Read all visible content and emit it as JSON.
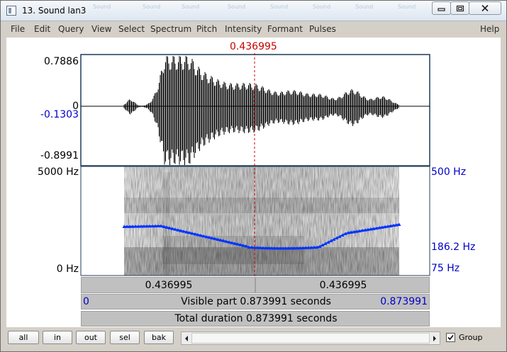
{
  "window": {
    "title": "13. Sound lan3",
    "ghost_titles": [
      "Sound",
      "Sound",
      "Sound",
      "Sound",
      "Sound",
      "Sound",
      "Sound",
      "Sound"
    ]
  },
  "menu": {
    "items": [
      "File",
      "Edit",
      "Query",
      "View",
      "Select",
      "Spectrum",
      "Pitch",
      "Intensity",
      "Formant",
      "Pulses"
    ],
    "help": "Help"
  },
  "cursor": {
    "time": "0.436995"
  },
  "waveform": {
    "max_label": "0.7886",
    "zero_label": "0",
    "cursor_value": "-0.1303",
    "min_label": "-0.8991"
  },
  "spectrogram": {
    "freq_max_label": "5000 Hz",
    "freq_min_label": "0 Hz",
    "pitch_max_label": "500 Hz",
    "pitch_mid_label": "186.2 Hz",
    "pitch_min_label": "75 Hz"
  },
  "time_bars": {
    "left_segment": "0.436995",
    "right_segment": "0.436995",
    "visible_start": "0",
    "visible_label": "Visible part 0.873991 seconds",
    "visible_end": "0.873991",
    "total_label": "Total duration 0.873991 seconds"
  },
  "bottom": {
    "buttons": [
      "all",
      "in",
      "out",
      "sel",
      "bak"
    ],
    "group_label": "Group",
    "group_checked": true
  },
  "colors": {
    "cursor": "#c80000",
    "axis_blue": "#0000c8",
    "pitch_line": "#0033ff"
  }
}
